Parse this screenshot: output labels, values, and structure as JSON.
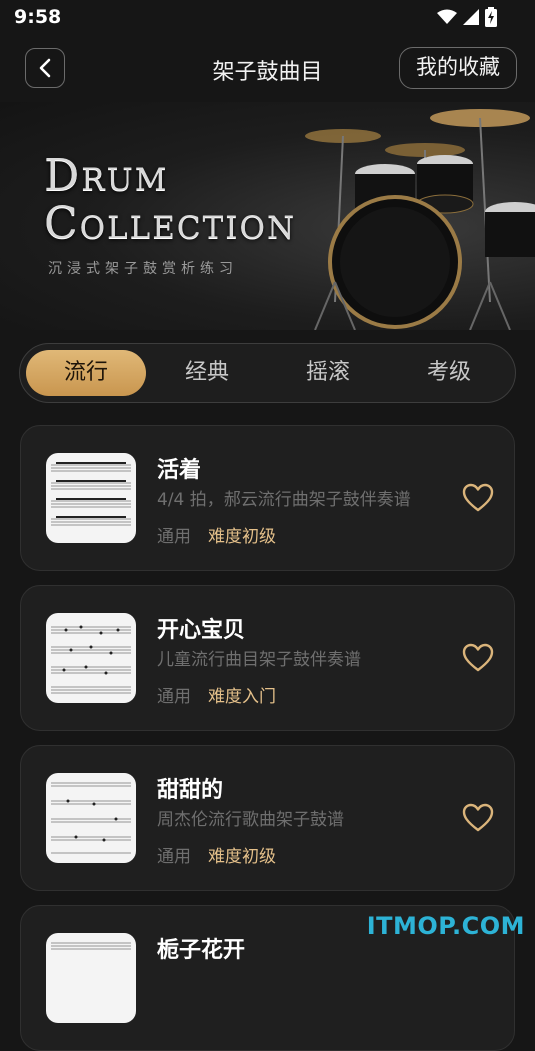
{
  "status_bar": {
    "time": "9:58"
  },
  "header": {
    "title": "架子鼓曲目",
    "favorites_label": "我的收藏"
  },
  "hero": {
    "title_line1": "Drum",
    "title_line2": "Collection",
    "subtitle": "沉浸式架子鼓赏析练习"
  },
  "tabs": [
    {
      "label": "流行",
      "active": true
    },
    {
      "label": "经典",
      "active": false
    },
    {
      "label": "摇滚",
      "active": false
    },
    {
      "label": "考级",
      "active": false
    }
  ],
  "songs": [
    {
      "title": "活着",
      "desc": "4/4 拍，郝云流行曲架子鼓伴奏谱",
      "tag": "通用",
      "level": "难度初级"
    },
    {
      "title": "开心宝贝",
      "desc": "儿童流行曲目架子鼓伴奏谱",
      "tag": "通用",
      "level": "难度入门"
    },
    {
      "title": "甜甜的",
      "desc": "周杰伦流行歌曲架子鼓谱",
      "tag": "通用",
      "level": "难度初级"
    },
    {
      "title": "栀子花开",
      "desc": "",
      "tag": "",
      "level": ""
    }
  ],
  "watermark": "ITMOP.COM",
  "colors": {
    "accent": "#d7aa65",
    "level": "#e4c08a",
    "background": "#161616"
  }
}
